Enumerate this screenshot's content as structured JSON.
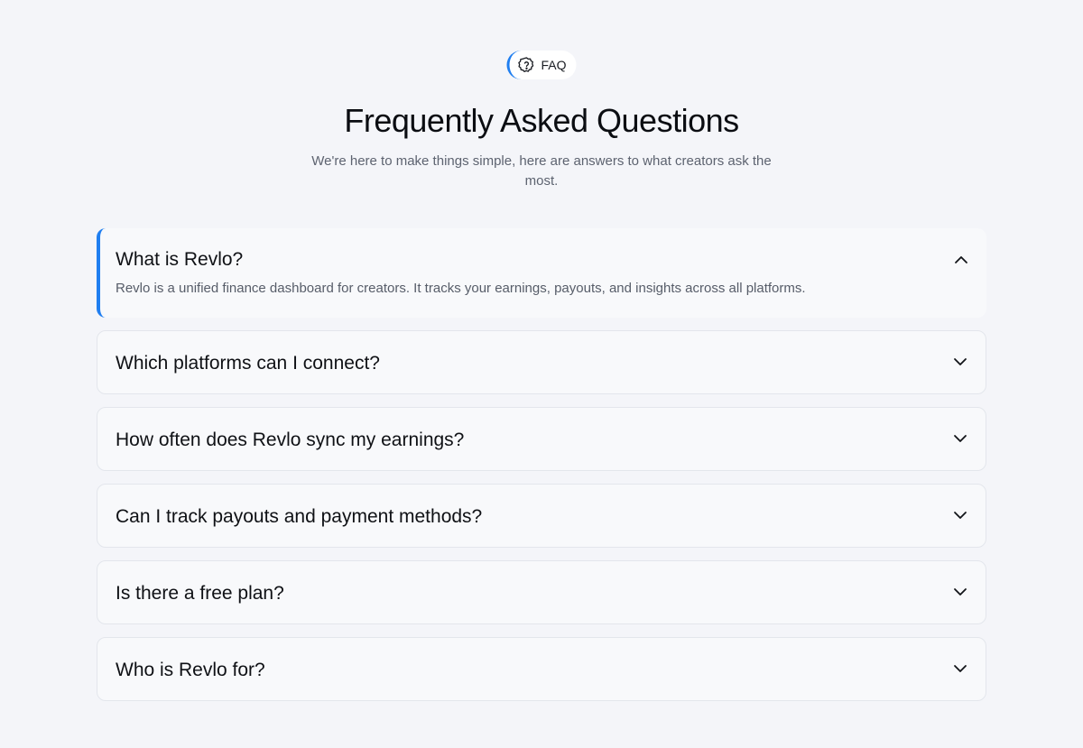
{
  "badge": {
    "label": "FAQ",
    "icon": "question-badge-icon"
  },
  "header": {
    "title": "Frequently Asked Questions",
    "subtitle": "We're here to make things simple, here are answers to what creators ask the most."
  },
  "faq": {
    "items": [
      {
        "question": "What is Revlo?",
        "answer": "Revlo is a unified finance dashboard for creators. It tracks your earnings, payouts, and insights across all platforms.",
        "expanded": true
      },
      {
        "question": "Which platforms can I connect?",
        "expanded": false
      },
      {
        "question": "How often does Revlo sync my earnings?",
        "expanded": false
      },
      {
        "question": "Can I track payouts and payment methods?",
        "expanded": false
      },
      {
        "question": "Is there a free plan?",
        "expanded": false
      },
      {
        "question": "Who is Revlo for?",
        "expanded": false
      }
    ]
  },
  "colors": {
    "accent": "#1f7ef0",
    "background": "#f4f5f9",
    "card": "#f8f9fb"
  }
}
